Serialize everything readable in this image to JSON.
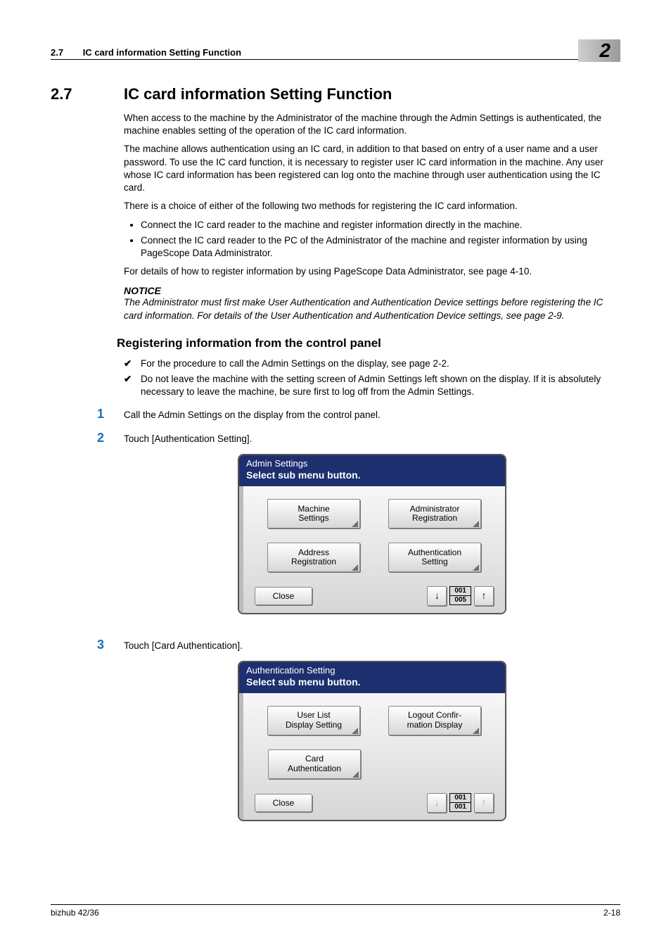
{
  "header": {
    "section_number": "2.7",
    "section_title": "IC card information Setting Function",
    "chapter": "2"
  },
  "section": {
    "number": "2.7",
    "title": "IC card information Setting Function",
    "para1": "When access to the machine by the Administrator of the machine through the Admin Settings is authenticated, the machine enables setting of the operation of the IC card information.",
    "para2": "The machine allows authentication using an IC card, in addition to that based on entry of a user name and a user password. To use the IC card function, it is necessary to register user IC card information in the machine. Any user whose IC card information has been registered can log onto the machine through user authentication using the IC card.",
    "para3": "There is a choice of either of the following two methods for registering the IC card information.",
    "bullet1": "Connect the IC card reader to the machine and register information directly in the machine.",
    "bullet2": "Connect the IC card reader to the PC of the Administrator of the machine and register information by using PageScope Data Administrator.",
    "para4": "For details of how to register information by using PageScope Data Administrator, see page 4-10.",
    "notice_head": "NOTICE",
    "notice_body": "The Administrator must first make User Authentication and Authentication Device settings before registering the IC card information. For details of the User Authentication and Authentication Device settings, see page 2-9."
  },
  "sub": {
    "title": "Registering information from the control panel",
    "check1": "For the procedure to call the Admin Settings on the display, see page 2-2.",
    "check2": "Do not leave the machine with the setting screen of Admin Settings left shown on the display. If it is absolutely necessary to leave the machine, be sure first to log off from the Admin Settings."
  },
  "steps": {
    "s1_num": "1",
    "s1_text": "Call the Admin Settings on the display from the control panel.",
    "s2_num": "2",
    "s2_text": "Touch [Authentication Setting].",
    "s3_num": "3",
    "s3_text": "Touch [Card Authentication]."
  },
  "panel1": {
    "title_line1": "Admin Settings",
    "title_line2": "Select sub menu button.",
    "btn1_l1": "Machine",
    "btn1_l2": "Settings",
    "btn2_l1": "Administrator",
    "btn2_l2": "Registration",
    "btn3_l1": "Address",
    "btn3_l2": "Registration",
    "btn4_l1": "Authentication",
    "btn4_l2": "Setting",
    "close": "Close",
    "page_now": "001",
    "page_total": "005"
  },
  "panel2": {
    "title_line1": "Authentication Setting",
    "title_line2": "Select sub menu button.",
    "btn1_l1": "User List",
    "btn1_l2": "Display Setting",
    "btn2_l1": "Logout Confir-",
    "btn2_l2": "mation Display",
    "btn3_l1": "Card",
    "btn3_l2": "Authentication",
    "close": "Close",
    "page_now": "001",
    "page_total": "001"
  },
  "footer": {
    "product": "bizhub 42/36",
    "page": "2-18"
  }
}
